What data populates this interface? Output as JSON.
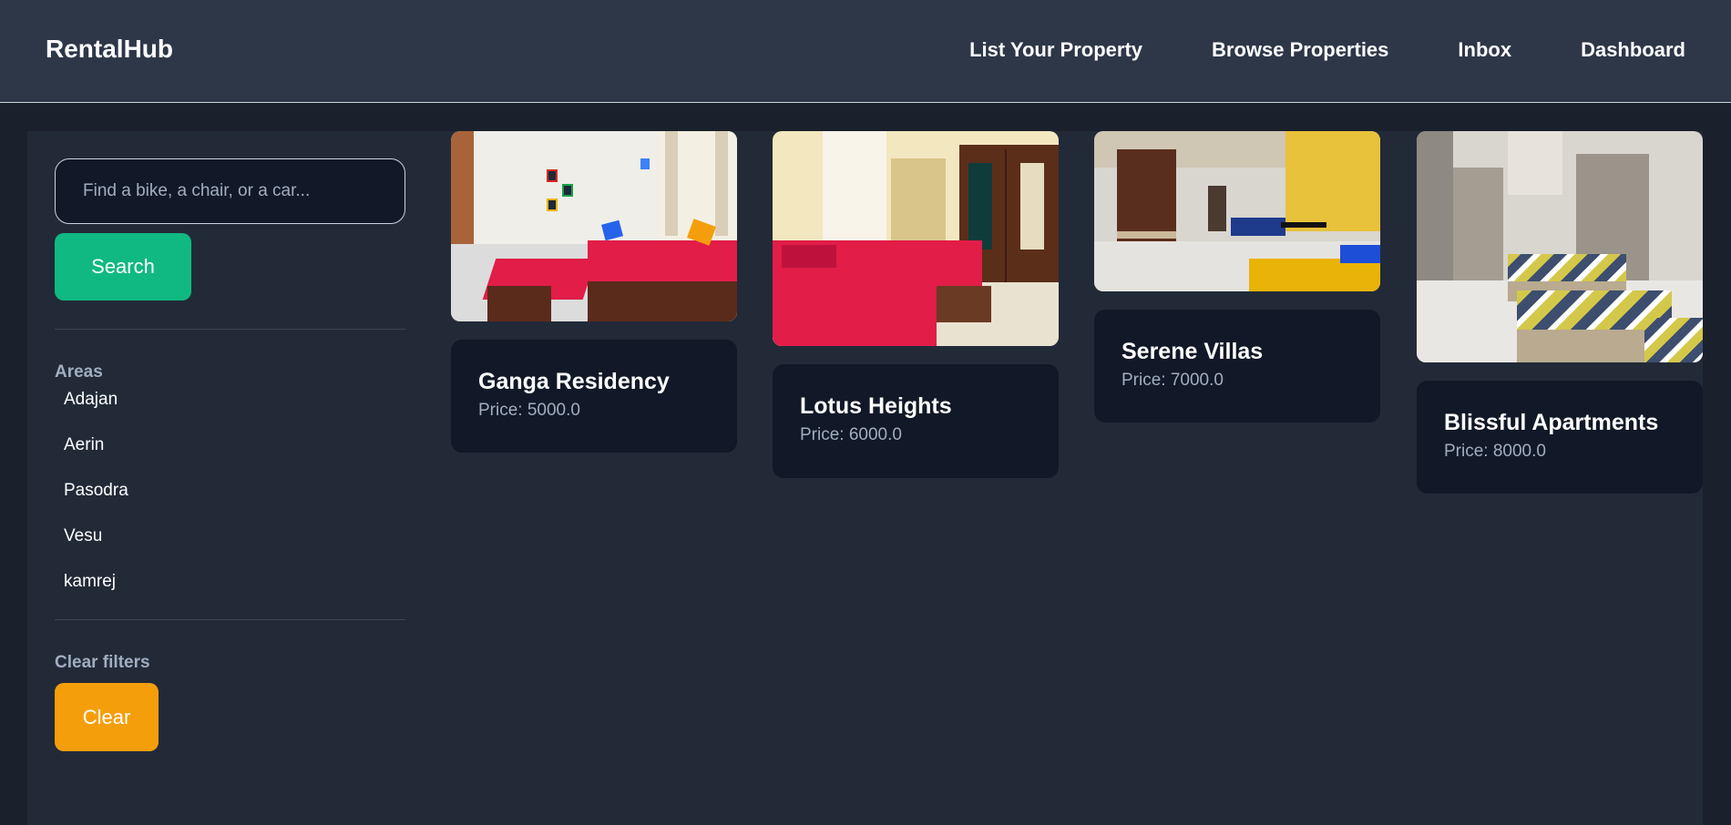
{
  "brand": "RentalHub",
  "nav": {
    "items": [
      {
        "label": "List Your Property"
      },
      {
        "label": "Browse Properties"
      },
      {
        "label": "Inbox"
      },
      {
        "label": "Dashboard"
      }
    ]
  },
  "sidebar": {
    "search_placeholder": "Find a bike, a chair, or a car...",
    "search_value": "",
    "search_button": "Search",
    "areas_label": "Areas",
    "areas": [
      "Adajan",
      "Aerin",
      "Pasodra",
      "Vesu",
      "kamrej"
    ],
    "clear_filters_label": "Clear filters",
    "clear_button": "Clear"
  },
  "listings": [
    {
      "name": "Ganga Residency",
      "price_label": "Price: ",
      "price": "5000.0",
      "image": "bedroom-photo"
    },
    {
      "name": "Lotus Heights",
      "price_label": "Price: ",
      "price": "6000.0",
      "image": "bedroom-photo"
    },
    {
      "name": "Serene Villas",
      "price_label": "Price: ",
      "price": "7000.0",
      "image": "bedroom-photo"
    },
    {
      "name": "Blissful Apartments",
      "price_label": "Price: ",
      "price": "8000.0",
      "image": "bedroom-photo"
    }
  ],
  "colors": {
    "navbar": "#2d3748",
    "background": "#1a202c",
    "panel": "#222a38",
    "card": "#111827",
    "search_button": "#10b981",
    "clear_button": "#f59e0b",
    "muted_text": "#a0aec0"
  }
}
